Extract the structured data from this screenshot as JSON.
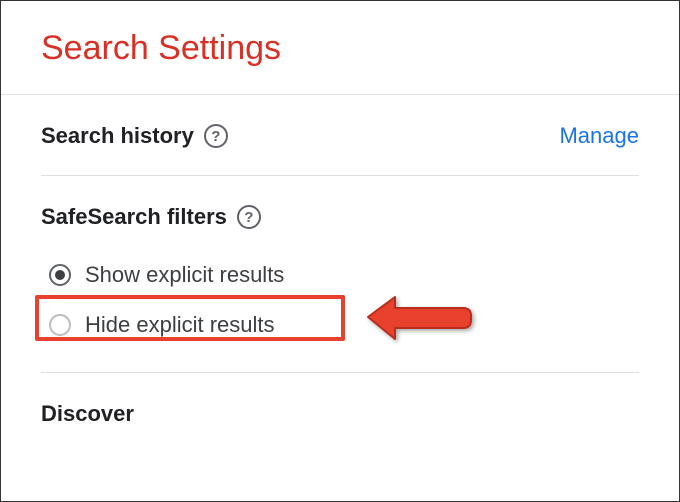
{
  "header": {
    "title": "Search Settings"
  },
  "searchHistory": {
    "title": "Search history",
    "manageLabel": "Manage"
  },
  "safeSearch": {
    "title": "SafeSearch filters",
    "options": [
      {
        "label": "Show explicit results",
        "selected": true
      },
      {
        "label": "Hide explicit results",
        "selected": false
      }
    ]
  },
  "discover": {
    "title": "Discover"
  },
  "helpTooltip": "?"
}
